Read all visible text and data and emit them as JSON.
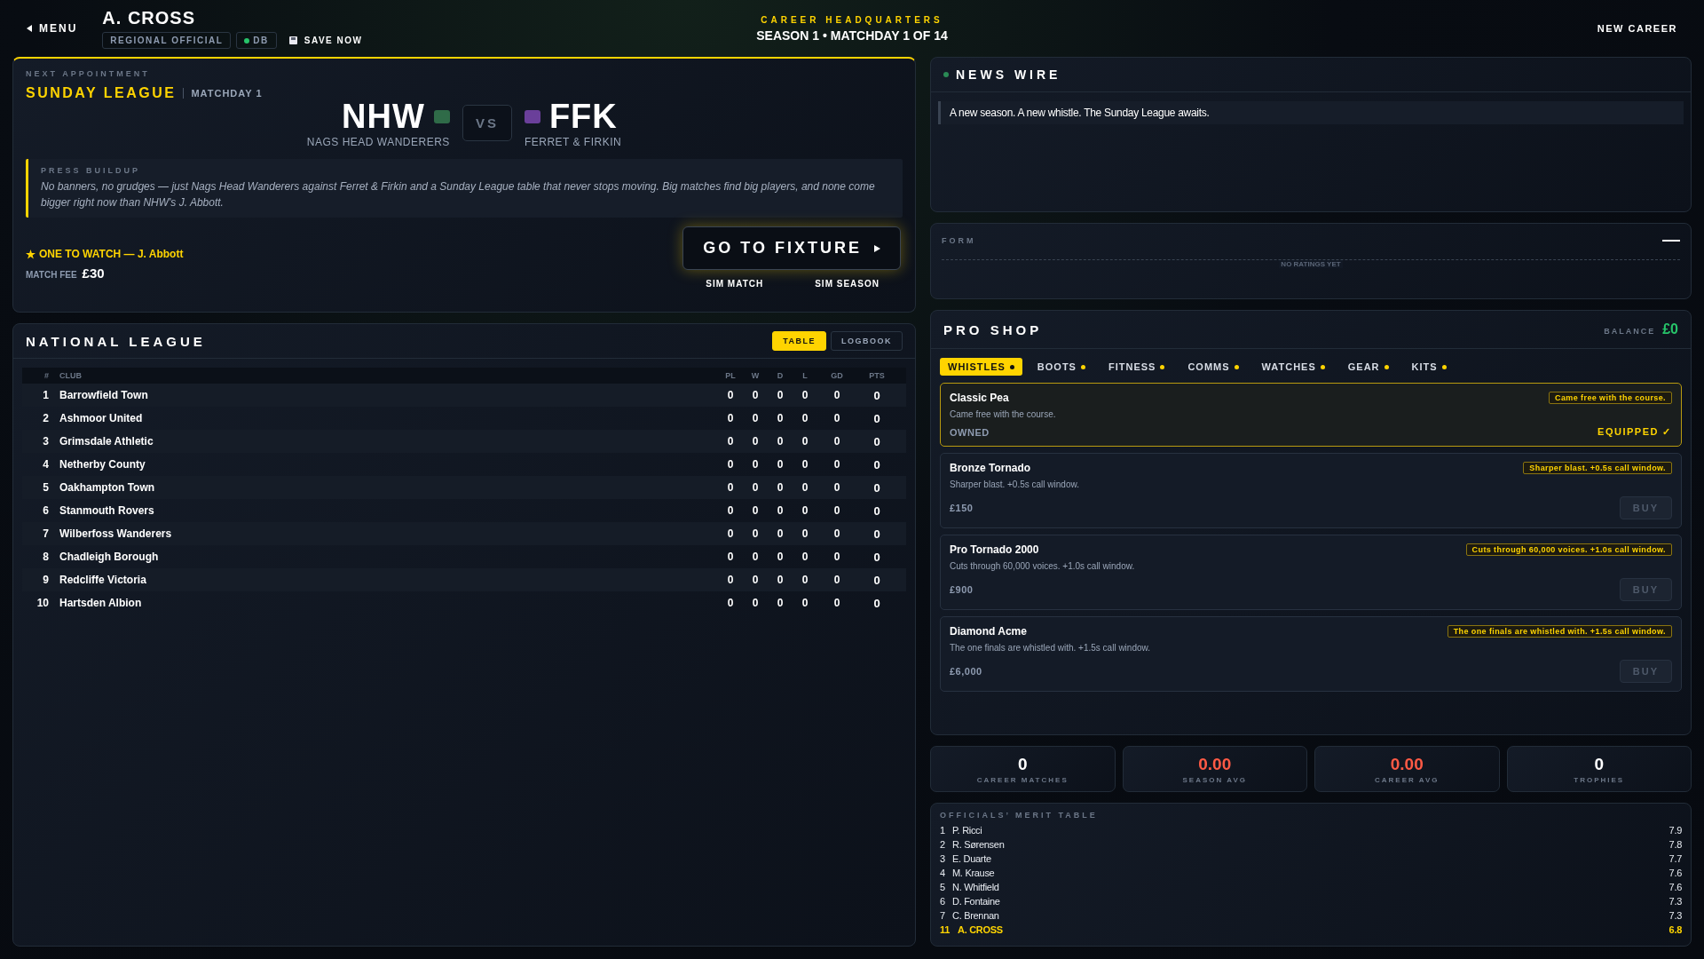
{
  "header": {
    "menu": "MENU",
    "name": "A. CROSS",
    "role": "REGIONAL OFFICIAL",
    "db": "DB",
    "save": "SAVE NOW",
    "eyebrow": "CAREER HEADQUARTERS",
    "season": "SEASON 1 • MATCHDAY 1 OF 14",
    "new_career": "NEW CAREER"
  },
  "fixture": {
    "eyebrow": "NEXT APPOINTMENT",
    "league": "SUNDAY LEAGUE",
    "matchday": "MATCHDAY 1",
    "home": {
      "abbr": "NHW",
      "name": "NAGS HEAD WANDERERS",
      "color": "#2f6b48"
    },
    "vs": "VS",
    "away": {
      "abbr": "FFK",
      "name": "FERRET & FIRKIN",
      "color": "#6a3f9a"
    },
    "press_label": "PRESS BUILDUP",
    "press": "No banners, no grudges — just Nags Head Wanderers against Ferret & Firkin and a Sunday League table that never stops moving. Big matches find big players, and none come bigger right now than NHW's J. Abbott.",
    "watch": "ONE TO WATCH — J. Abbott",
    "fee_label": "MATCH FEE",
    "fee": "£30",
    "go": "GO TO FIXTURE",
    "sim_match": "SIM MATCH",
    "sim_season": "SIM SEASON"
  },
  "league": {
    "title": "NATIONAL LEAGUE",
    "tabs": [
      {
        "label": "TABLE",
        "selected": true
      },
      {
        "label": "LOGBOOK",
        "selected": false
      }
    ],
    "columns": [
      "#",
      "CLUB",
      "PL",
      "W",
      "D",
      "L",
      "GD",
      "PTS"
    ],
    "rows": [
      [
        "1",
        "Barrowfield Town",
        "0",
        "0",
        "0",
        "0",
        "0",
        "0"
      ],
      [
        "2",
        "Ashmoor United",
        "0",
        "0",
        "0",
        "0",
        "0",
        "0"
      ],
      [
        "3",
        "Grimsdale Athletic",
        "0",
        "0",
        "0",
        "0",
        "0",
        "0"
      ],
      [
        "4",
        "Netherby County",
        "0",
        "0",
        "0",
        "0",
        "0",
        "0"
      ],
      [
        "5",
        "Oakhampton Town",
        "0",
        "0",
        "0",
        "0",
        "0",
        "0"
      ],
      [
        "6",
        "Stanmouth Rovers",
        "0",
        "0",
        "0",
        "0",
        "0",
        "0"
      ],
      [
        "7",
        "Wilberfoss Wanderers",
        "0",
        "0",
        "0",
        "0",
        "0",
        "0"
      ],
      [
        "8",
        "Chadleigh Borough",
        "0",
        "0",
        "0",
        "0",
        "0",
        "0"
      ],
      [
        "9",
        "Redcliffe Victoria",
        "0",
        "0",
        "0",
        "0",
        "0",
        "0"
      ],
      [
        "10",
        "Hartsden Albion",
        "0",
        "0",
        "0",
        "0",
        "0",
        "0"
      ]
    ]
  },
  "news": {
    "title": "NEWS WIRE",
    "items": [
      "A new season. A new whistle. The Sunday League awaits."
    ]
  },
  "form": {
    "label": "FORM",
    "empty": "NO RATINGS YET"
  },
  "shop": {
    "title": "PRO SHOP",
    "balance_label": "BALANCE",
    "balance": "£0",
    "tabs": [
      {
        "label": "WHISTLES",
        "selected": true
      },
      {
        "label": "BOOTS",
        "selected": false
      },
      {
        "label": "FITNESS",
        "selected": false
      },
      {
        "label": "COMMS",
        "selected": false
      },
      {
        "label": "WATCHES",
        "selected": false
      },
      {
        "label": "GEAR",
        "selected": false
      },
      {
        "label": "KITS",
        "selected": false
      }
    ],
    "items": [
      {
        "name": "Classic Pea",
        "desc": "Came free with the course.",
        "tag": "Came free with the course.",
        "status": "OWNED",
        "action": "EQUIPPED ✓",
        "kind": "equipped"
      },
      {
        "name": "Bronze Tornado",
        "desc": "Sharper blast. +0.5s call window.",
        "tag": "Sharper blast. +0.5s call window.",
        "status": "£150",
        "action": "BUY",
        "kind": "buy"
      },
      {
        "name": "Pro Tornado 2000",
        "desc": "Cuts through 60,000 voices. +1.0s call window.",
        "tag": "Cuts through 60,000 voices. +1.0s call window.",
        "status": "£900",
        "action": "BUY",
        "kind": "buy"
      },
      {
        "name": "Diamond Acme",
        "desc": "The one finals are whistled with. +1.5s call window.",
        "tag": "The one finals are whistled with. +1.5s call window.",
        "status": "£6,000",
        "action": "BUY",
        "kind": "buy"
      }
    ]
  },
  "stats": [
    {
      "value": "0",
      "label": "CAREER MATCHES",
      "color": "#ffffff"
    },
    {
      "value": "0.00",
      "label": "SEASON AVG",
      "color": "#ff5a45"
    },
    {
      "value": "0.00",
      "label": "CAREER AVG",
      "color": "#ff5a45"
    },
    {
      "value": "0",
      "label": "TROPHIES",
      "color": "#ffffff"
    }
  ],
  "merit": {
    "title": "OFFICIALS’ MERIT TABLE",
    "rows": [
      {
        "rank": "1",
        "name": "P. Ricci",
        "score": "7.9",
        "selected": false
      },
      {
        "rank": "2",
        "name": "R. Sørensen",
        "score": "7.8",
        "selected": false
      },
      {
        "rank": "3",
        "name": "E. Duarte",
        "score": "7.7",
        "selected": false
      },
      {
        "rank": "4",
        "name": "M. Krause",
        "score": "7.6",
        "selected": false
      },
      {
        "rank": "5",
        "name": "N. Whitfield",
        "score": "7.6",
        "selected": false
      },
      {
        "rank": "6",
        "name": "D. Fontaine",
        "score": "7.3",
        "selected": false
      },
      {
        "rank": "7",
        "name": "C. Brennan",
        "score": "7.3",
        "selected": false
      },
      {
        "rank": "11",
        "name": "A. CROSS",
        "score": "6.8",
        "selected": true
      }
    ]
  }
}
